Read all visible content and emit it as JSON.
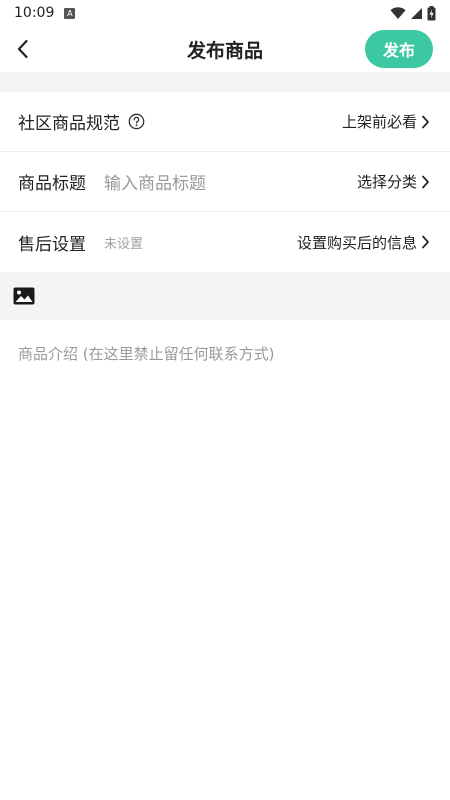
{
  "status_bar": {
    "time": "10:09",
    "notification_icon": "a-letter-icon",
    "icons": [
      "wifi-icon",
      "cell-signal-icon",
      "battery-charging-icon"
    ]
  },
  "header": {
    "title": "发布商品",
    "back_icon": "chevron-left-icon",
    "publish_label": "发布",
    "accent_color": "#3cc8a2"
  },
  "rows": {
    "rules": {
      "label": "社区商品规范",
      "link": "上架前必看"
    },
    "title": {
      "label": "商品标题",
      "placeholder": "输入商品标题",
      "link": "选择分类"
    },
    "after_sale": {
      "label": "售后设置",
      "value": "未设置",
      "link": "设置购买后的信息"
    }
  },
  "editor": {
    "toolbar_icon": "image-icon",
    "description_placeholder": "商品介绍 (在这里禁止留任何联系方式)"
  }
}
